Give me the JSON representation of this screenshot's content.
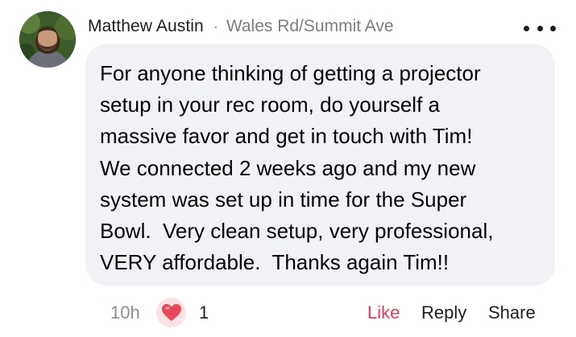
{
  "comment": {
    "author": "Matthew Austin",
    "separator": "·",
    "location": "Wales Rd/Summit Ave",
    "body": "For anyone thinking of getting a projector\nsetup in your rec room, do yourself a\nmassive favor and get in touch with Tim!\nWe connected 2 weeks ago and my new\nsystem was set up in time for the Super\nBowl.  Very clean setup, very professional,\nVERY affordable.  Thanks again Tim!!"
  },
  "footer": {
    "timestamp": "10h",
    "reaction_icon": "heart-icon",
    "reaction_count": "1",
    "like_label": "Like",
    "reply_label": "Reply",
    "share_label": "Share"
  },
  "colors": {
    "bubble_bg": "#f0f2f5",
    "like_active": "#d93f56",
    "heart": "#e8465a",
    "muted_text": "#8a8d91"
  }
}
